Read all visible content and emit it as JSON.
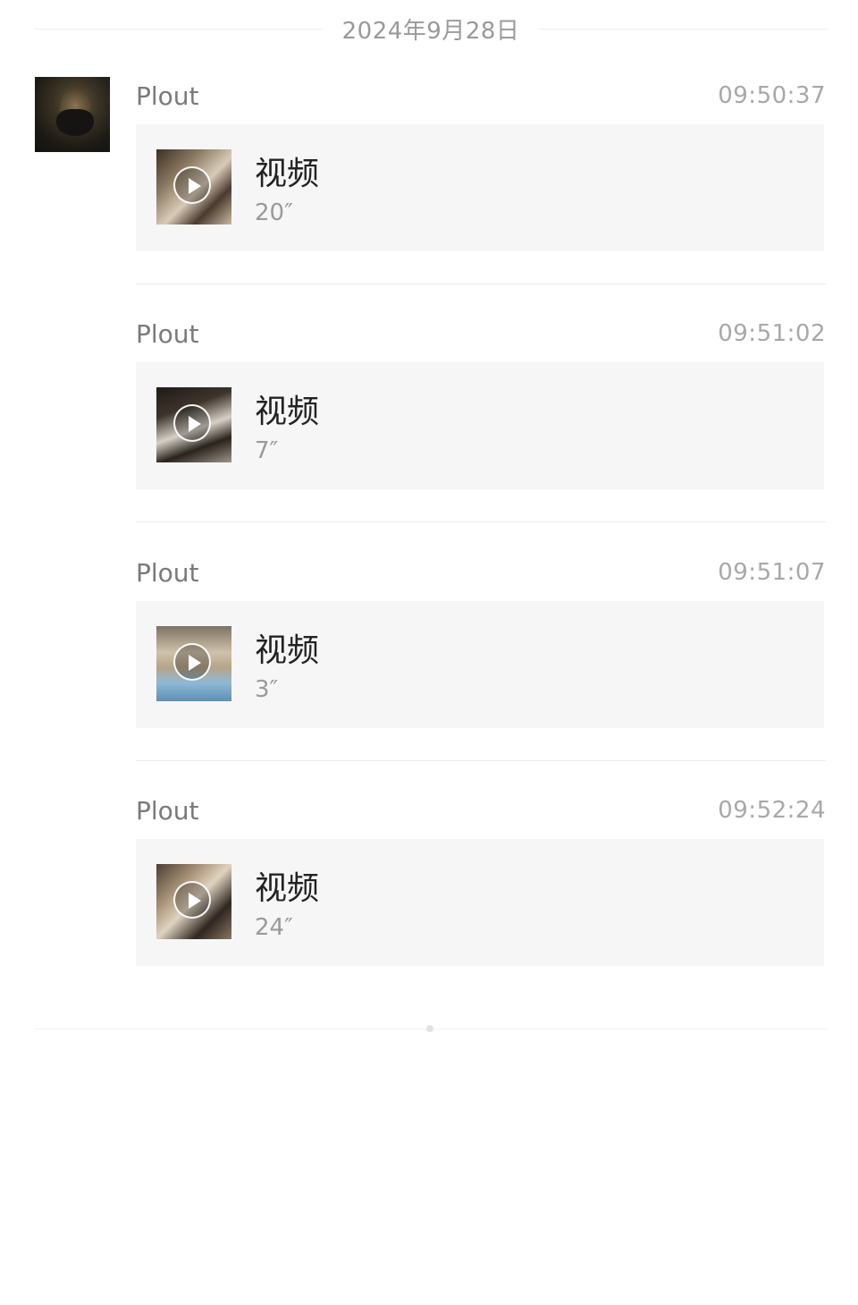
{
  "date_divider": "2024年9月28日",
  "avatar_icon": "avatar-photo",
  "messages": [
    {
      "sender": "Plout",
      "time": "09:50:37",
      "title": "视频",
      "duration": "20″"
    },
    {
      "sender": "Plout",
      "time": "09:51:02",
      "title": "视频",
      "duration": "7″"
    },
    {
      "sender": "Plout",
      "time": "09:51:07",
      "title": "视频",
      "duration": "3″"
    },
    {
      "sender": "Plout",
      "time": "09:52:24",
      "title": "视频",
      "duration": "24″"
    }
  ]
}
